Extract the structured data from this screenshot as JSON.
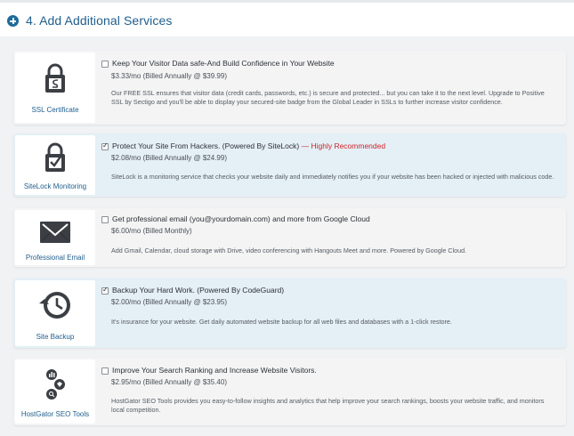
{
  "section": {
    "title": "4. Add Additional Services"
  },
  "services": [
    {
      "name": "SSL Certificate",
      "icon": "lock-certificate-icon",
      "checked": false,
      "headline": "Keep Your Visitor Data safe-And Build Confidence in Your Website",
      "recommended": "",
      "price": "$3.33/mo (Billed Annually @ $39.99)",
      "description": "Our FREE SSL ensures that visitor data (credit cards, passwords, etc.) is secure and protected... but you can take it to the next level. Upgrade to Positive SSL by Sectigo and you'll be able to display your secured-site badge from the Global Leader in SSLs to further increase visitor confidence."
    },
    {
      "name": "SiteLock Monitoring",
      "icon": "lock-check-icon",
      "checked": true,
      "headline": "Protect Your Site From Hackers. (Powered By SiteLock)",
      "recommended": " — Highly Recommended",
      "price": "$2.08/mo (Billed Annually @ $24.99)",
      "description": "SiteLock is a monitoring service that checks your website daily and immediately notifies you if your website has been hacked or injected with malicious code."
    },
    {
      "name": "Professional Email",
      "icon": "envelope-icon",
      "checked": false,
      "headline": "Get professional email (you@yourdomain.com) and more from Google Cloud",
      "recommended": "",
      "price": "$6.00/mo (Billed Monthly)",
      "description": "Add Gmail, Calendar, cloud storage with Drive, video conferencing with Hangouts Meet and more. Powered by Google Cloud."
    },
    {
      "name": "Site Backup",
      "icon": "clock-backup-icon",
      "checked": true,
      "headline": "Backup Your Hard Work. (Powered By CodeGuard)",
      "recommended": "",
      "price": "$2.00/mo (Billed Annually @ $23.95)",
      "description": "It's insurance for your website. Get daily automated website backup for all web files and databases with a 1-click restore."
    },
    {
      "name": "HostGator SEO Tools",
      "icon": "seo-tools-icon",
      "checked": false,
      "headline": "Improve Your Search Ranking and Increase Website Visitors.",
      "recommended": "",
      "price": "$2.95/mo (Billed Annually @ $35.40)",
      "description": "HostGator SEO Tools provides you easy-to-follow insights and analytics that help improve your search rankings, boosts your website traffic, and monitors local competition."
    }
  ],
  "colors": {
    "accent": "#1f5e8c",
    "recommended": "#d0252a",
    "selected_bg": "#e4eff6"
  }
}
